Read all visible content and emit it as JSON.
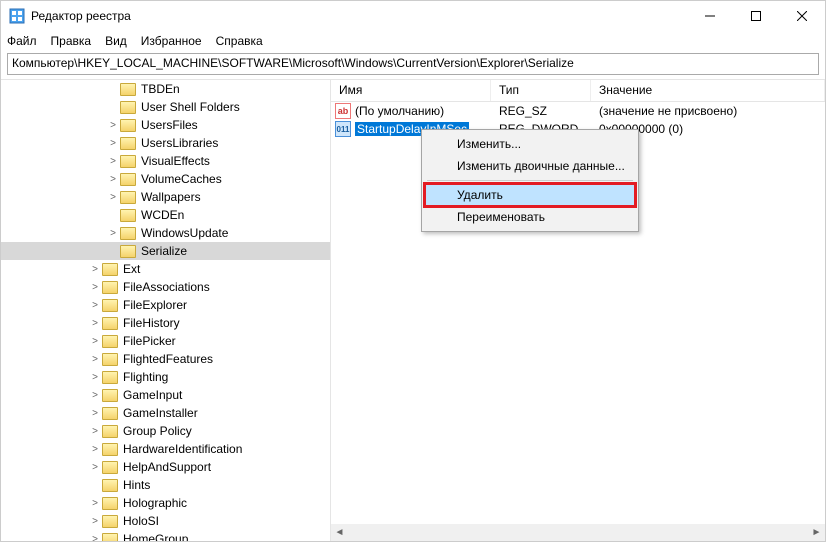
{
  "window": {
    "title": "Редактор реестра"
  },
  "menu": {
    "file": "Файл",
    "edit": "Правка",
    "view": "Вид",
    "fav": "Избранное",
    "help": "Справка"
  },
  "address": "Компьютер\\HKEY_LOCAL_MACHINE\\SOFTWARE\\Microsoft\\Windows\\CurrentVersion\\Explorer\\Serialize",
  "tree": {
    "items": [
      "TBDEn",
      "User Shell Folders",
      "UsersFiles",
      "UsersLibraries",
      "VisualEffects",
      "VolumeCaches",
      "Wallpapers",
      "WCDEn",
      "WindowsUpdate",
      "Serialize",
      "Ext",
      "FileAssociations",
      "FileExplorer",
      "FileHistory",
      "FilePicker",
      "FlightedFeatures",
      "Flighting",
      "GameInput",
      "GameInstaller",
      "Group Policy",
      "HardwareIdentification",
      "HelpAndSupport",
      "Hints",
      "Holographic",
      "HoloSI",
      "HomeGroup"
    ],
    "selected_index": 9,
    "twisty": {
      "0": "",
      "1": "",
      "2": ">",
      "3": ">",
      "4": ">",
      "5": ">",
      "6": ">",
      "7": "",
      "8": ">",
      "9": "",
      "10": ">",
      "11": ">",
      "12": ">",
      "13": ">",
      "14": ">",
      "15": ">",
      "16": ">",
      "17": ">",
      "18": ">",
      "19": ">",
      "20": ">",
      "21": ">",
      "22": "",
      "23": ">",
      "24": ">",
      "25": ">"
    },
    "depth": {
      "0": 2,
      "1": 2,
      "2": 2,
      "3": 2,
      "4": 2,
      "5": 2,
      "6": 2,
      "7": 2,
      "8": 2,
      "9": 2,
      "10": 1,
      "11": 1,
      "12": 1,
      "13": 1,
      "14": 1,
      "15": 1,
      "16": 1,
      "17": 1,
      "18": 1,
      "19": 1,
      "20": 1,
      "21": 1,
      "22": 1,
      "23": 1,
      "24": 1,
      "25": 1
    }
  },
  "columns": {
    "name": "Имя",
    "type": "Тип",
    "value": "Значение"
  },
  "values": [
    {
      "icon": "ab",
      "name": "(По умолчанию)",
      "type": "REG_SZ",
      "value": "(значение не присвоено)",
      "selected": false
    },
    {
      "icon": "bin",
      "name": "StartupDelayInMSec",
      "type": "REG_DWORD",
      "value": "0x00000000 (0)",
      "selected": true
    }
  ],
  "context_menu": {
    "items": [
      {
        "label": "Изменить...",
        "highlight": false
      },
      {
        "label": "Изменить двоичные данные...",
        "highlight": false
      },
      {
        "sep": true
      },
      {
        "label": "Удалить",
        "highlight": true
      },
      {
        "label": "Переименовать",
        "highlight": false
      }
    ]
  }
}
